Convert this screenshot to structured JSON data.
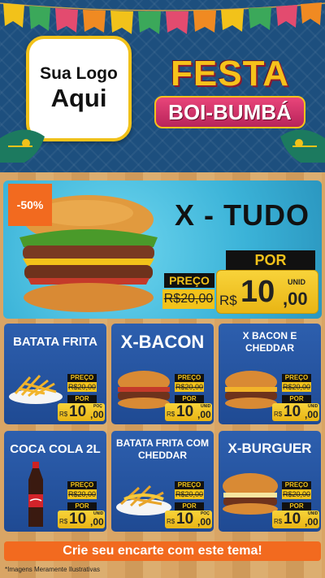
{
  "logo": {
    "line1": "Sua Logo",
    "line2": "Aqui"
  },
  "festival": {
    "title": "FESTA",
    "subtitle": "BOI-BUMBÁ"
  },
  "hero": {
    "badge": "-50%",
    "name": "X - TUDO",
    "preco_label": "PREÇO",
    "old_price": "R$20,00",
    "por_label": "POR",
    "currency": "R$",
    "price_int": "10",
    "price_cents": ",00",
    "unit": "UNID"
  },
  "products": [
    {
      "name": "BATATA FRITA",
      "preco_label": "PREÇO",
      "old_price": "R$20,00",
      "por_label": "POR",
      "currency": "R$",
      "price_int": "10",
      "price_cents": ",00",
      "unit": "POÇ"
    },
    {
      "name": "X-BACON",
      "preco_label": "PREÇO",
      "old_price": "R$20,00",
      "por_label": "POR",
      "currency": "R$",
      "price_int": "10",
      "price_cents": ",00",
      "unit": "UNID"
    },
    {
      "name": "X BACON E CHEDDAR",
      "preco_label": "PREÇO",
      "old_price": "R$20,00",
      "por_label": "POR",
      "currency": "R$",
      "price_int": "10",
      "price_cents": ",00",
      "unit": "UNID"
    },
    {
      "name": "COCA COLA 2L",
      "preco_label": "PREÇO",
      "old_price": "R$20,00",
      "por_label": "POR",
      "currency": "R$",
      "price_int": "10",
      "price_cents": ",00",
      "unit": "UNID"
    },
    {
      "name": "BATATA FRITA COM CHEDDAR",
      "preco_label": "PREÇO",
      "old_price": "R$20,00",
      "por_label": "POR",
      "currency": "R$",
      "price_int": "10",
      "price_cents": ",00",
      "unit": "POÇ"
    },
    {
      "name": "X-BURGUER",
      "preco_label": "PREÇO",
      "old_price": "R$20,00",
      "por_label": "POR",
      "currency": "R$",
      "price_int": "10",
      "price_cents": ",00",
      "unit": "UNID"
    }
  ],
  "cta": "Crie seu encarte com este tema!",
  "disclaimer": "*Imagens Meramente Ilustrativas",
  "colors": {
    "header_bg": "#1d4f7e",
    "card_bg": "#2d5fae",
    "price_yellow": "#f2c21a",
    "accent_orange": "#f26a1f",
    "hero_bg": "#3bb3d8"
  }
}
